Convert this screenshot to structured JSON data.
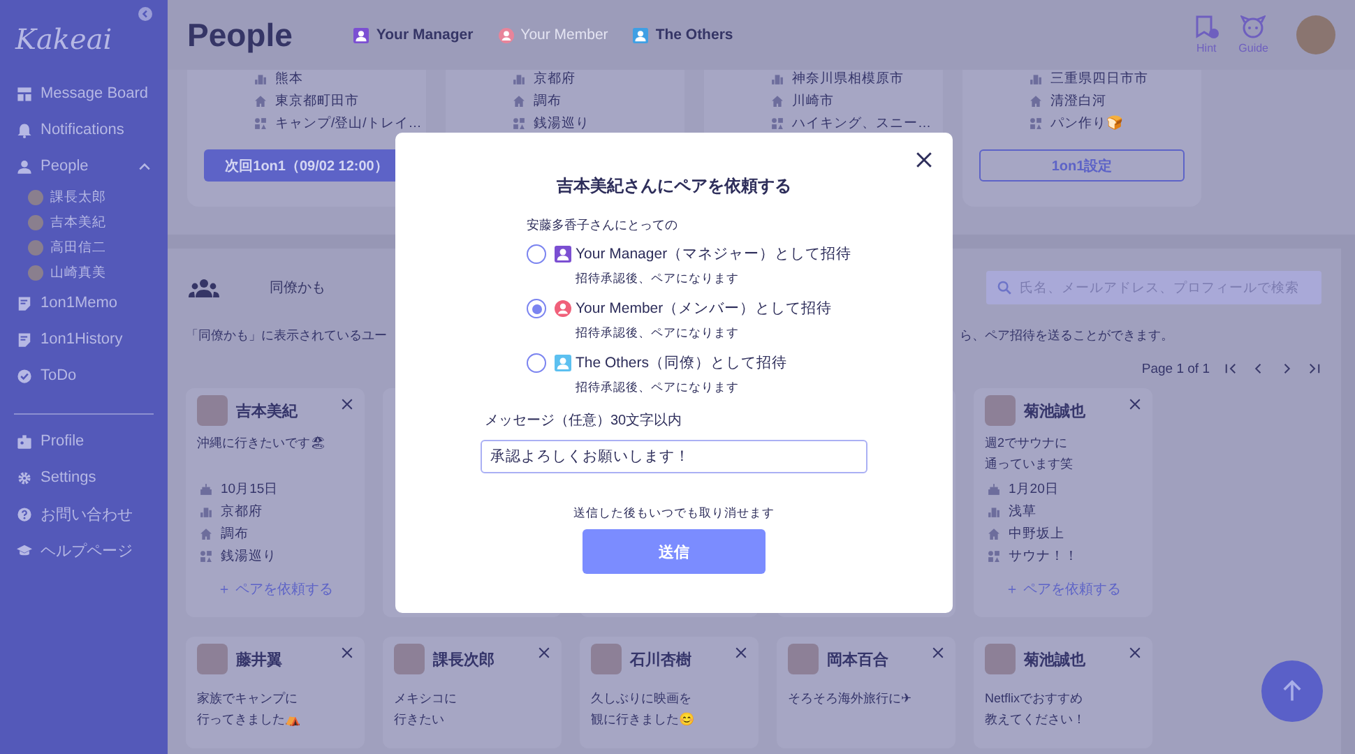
{
  "sidebar": {
    "logo": "Kakeai",
    "items": [
      {
        "label": "Message Board"
      },
      {
        "label": "Notifications"
      },
      {
        "label": "People",
        "expanded": true,
        "children": [
          {
            "label": "課長太郎"
          },
          {
            "label": "吉本美紀"
          },
          {
            "label": "高田信二"
          },
          {
            "label": "山崎真美"
          }
        ]
      },
      {
        "label": "1on1Memo"
      },
      {
        "label": "1on1History"
      },
      {
        "label": "ToDo"
      }
    ],
    "bottom_items": [
      {
        "label": "Profile"
      },
      {
        "label": "Settings"
      },
      {
        "label": "お問い合わせ"
      },
      {
        "label": "ヘルプページ"
      }
    ]
  },
  "header": {
    "title": "People",
    "filters": [
      {
        "label": "Your Manager",
        "active": true,
        "color": "#7b4fd2"
      },
      {
        "label": "Your Member",
        "active": false,
        "color": "#e8849a"
      },
      {
        "label": "The Others",
        "active": true,
        "color": "#3f9fe4"
      }
    ],
    "actions": [
      {
        "label": "Hint"
      },
      {
        "label": "Guide"
      }
    ]
  },
  "top_cards": [
    {
      "details": [
        {
          "kind": "hometown",
          "text": "熊本"
        },
        {
          "kind": "residence",
          "text": "東京都町田市"
        },
        {
          "kind": "hobby",
          "text": "キャンプ/登山/トレイ…"
        }
      ],
      "button": {
        "label": "次回1on1（09/02 12:00）",
        "kind": "filled"
      }
    },
    {
      "details": [
        {
          "kind": "hometown",
          "text": "京都府"
        },
        {
          "kind": "residence",
          "text": "調布"
        },
        {
          "kind": "hobby",
          "text": "銭湯巡り"
        }
      ]
    },
    {
      "details": [
        {
          "kind": "hometown",
          "text": "神奈川県相模原市"
        },
        {
          "kind": "residence",
          "text": "川崎市"
        },
        {
          "kind": "hobby",
          "text": "ハイキング、スニー…"
        }
      ]
    },
    {
      "details": [
        {
          "kind": "hometown",
          "text": "三重県四日市市"
        },
        {
          "kind": "residence",
          "text": "清澄白河"
        },
        {
          "kind": "hobby",
          "text": "パン作り🍞"
        }
      ],
      "button": {
        "label": "1on1設定",
        "kind": "outline"
      }
    }
  ],
  "colleagues": {
    "tab": "同僚かも",
    "search": {
      "placeholder": "氏名、メールアドレス、プロフィールで検索"
    },
    "info_texts": [
      "「同僚かも」に表示されているユー",
      "ら、ペア招待を送ることができます。"
    ],
    "pagination": "Page 1 of 1",
    "first_row": [
      {
        "name": "吉本美紀",
        "message_lines": [
          "沖縄に行きたいです🏖"
        ],
        "details": [
          {
            "kind": "birthday",
            "text": "10月15日"
          },
          {
            "kind": "hometown",
            "text": "京都府"
          },
          {
            "kind": "residence",
            "text": "調布"
          },
          {
            "kind": "hobby",
            "text": "銭湯巡り"
          }
        ],
        "action": "＋ ペアを依頼する"
      },
      {
        "name": "菊池誠也",
        "message_lines": [
          "週2でサウナに",
          "通っています笑"
        ],
        "details": [
          {
            "kind": "birthday",
            "text": "1月20日"
          },
          {
            "kind": "hometown",
            "text": "浅草"
          },
          {
            "kind": "residence",
            "text": "中野坂上"
          },
          {
            "kind": "hobby",
            "text": "サウナ！！"
          }
        ],
        "action": "＋ ペアを依頼する"
      }
    ],
    "second_row": [
      {
        "name": "藤井翼",
        "message_lines": [
          "家族でキャンプに",
          "行ってきました⛺"
        ]
      },
      {
        "name": "課長次郎",
        "message_lines": [
          "メキシコに",
          "行きたい"
        ]
      },
      {
        "name": "石川杏樹",
        "message_lines": [
          "久しぶりに映画を",
          "観に行きました😊"
        ]
      },
      {
        "name": "岡本百合",
        "message_lines": [
          "そろそろ海外旅行に✈"
        ]
      },
      {
        "name": "菊池誠也",
        "message_lines": [
          "Netflixでおすすめ",
          "教えてください！"
        ]
      }
    ]
  },
  "modal": {
    "title": "吉本美紀さんにペアを依頼する",
    "subtitle": "安藤多香子さんにとっての",
    "options": [
      {
        "label": "Your Manager（マネジャー）として招待",
        "note": "招待承認後、ペアになります",
        "selected": false,
        "color": "#7b4fd2"
      },
      {
        "label": "Your Member（メンバー）として招待",
        "note": "招待承認後、ペアになります",
        "selected": true,
        "color": "#f0607a"
      },
      {
        "label": "The Others（同僚）として招待",
        "note": "招待承認後、ペアになります",
        "selected": false,
        "color": "#5cc0f0"
      }
    ],
    "message_label": "メッセージ（任意）30文字以内",
    "message_value": "承認よろしくお願いします！",
    "note": "送信した後もいつでも取り消せます",
    "submit": "送信"
  }
}
